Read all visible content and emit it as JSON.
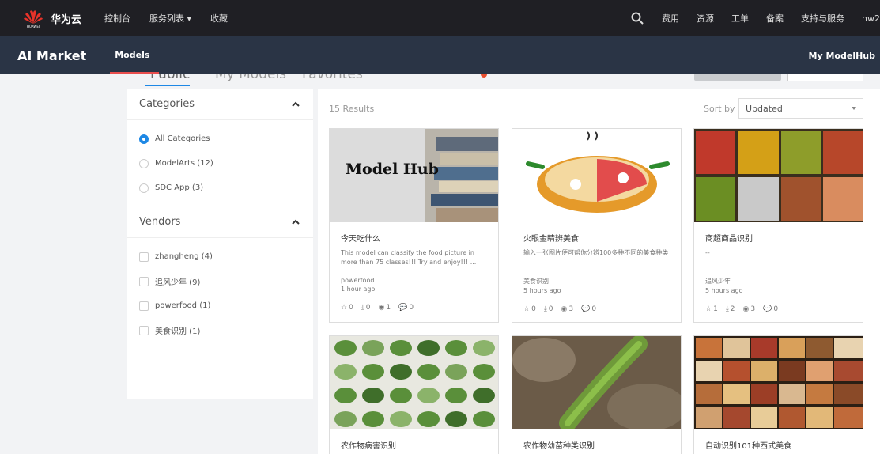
{
  "topbar": {
    "brand": "华为云",
    "nav": [
      "控制台",
      "服务列表 ▾",
      "收藏"
    ],
    "right": [
      "费用",
      "资源",
      "工单",
      "备案",
      "支持与服务",
      "hw2"
    ]
  },
  "subbar": {
    "title": "AI Market",
    "models": "Models",
    "myhub": "My ModelHub"
  },
  "tabs": [
    "Public",
    "My Models",
    "Favorites"
  ],
  "sidebar": {
    "categories_title": "Categories",
    "categories": [
      {
        "label": "All Categories",
        "selected": true
      },
      {
        "label": "ModelArts  (12)",
        "selected": false
      },
      {
        "label": "SDC App  (3)",
        "selected": false
      }
    ],
    "vendors_title": "Vendors",
    "vendors": [
      "zhangheng  (4)",
      "追风少年  (9)",
      "powerfood  (1)",
      "美食识别  (1)"
    ]
  },
  "main": {
    "results": "15 Results",
    "sort_label": "Sort by",
    "sort_value": "Updated",
    "cards": [
      {
        "name": "今天吃什么",
        "desc": "This model can classify the food picture in more than 75 classes!!! Try and enjoy!!! ...",
        "vendor": "powerfood",
        "time": "1 hour ago",
        "stars": "0",
        "downloads": "0",
        "views": "1",
        "comments": "0",
        "img_text": "Model Hub"
      },
      {
        "name": "火眼金睛辨美食",
        "desc": "输入一张图片便可帮你分辨100多种不同的美食种类",
        "vendor": "美食识别",
        "time": "5 hours ago",
        "stars": "0",
        "downloads": "0",
        "views": "3",
        "comments": "0"
      },
      {
        "name": "商超商品识别",
        "desc": "--",
        "vendor": "追风少年",
        "time": "5 hours ago",
        "stars": "1",
        "downloads": "2",
        "views": "3",
        "comments": "0"
      },
      {
        "name": "农作物病害识别"
      },
      {
        "name": "农作物幼苗种类识别"
      },
      {
        "name": "自动识别101种西式美食"
      }
    ]
  },
  "colors": {
    "topbar": "#1f1f24",
    "subbar": "#2a3445",
    "accent": "#1e88e5",
    "tab_red": "#e94e4e"
  }
}
